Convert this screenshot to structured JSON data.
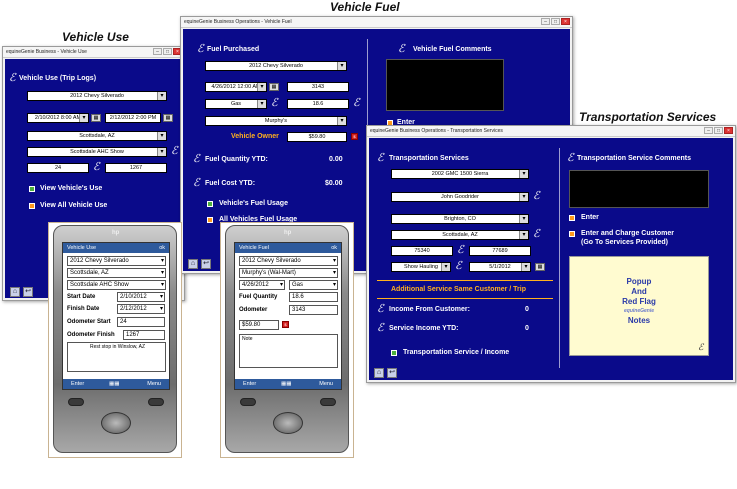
{
  "captions": {
    "vehicle_use": "Vehicle Use",
    "vehicle_fuel": "Vehicle Fuel",
    "transport": "Transportation Services"
  },
  "win_use": {
    "title": "equineGenie   Business - Vehicle Use",
    "heading": "Vehicle Use (Trip Logs)",
    "vehicle": "2012 Chevy Silverado",
    "start": "2/10/2012 8:00 AM",
    "finish": "2/12/2012 2:00 PM",
    "location": "Scottsdale, AZ",
    "event": "Scottsdale AHC Show",
    "odo_start": "24",
    "odo_finish": "1267",
    "btn_view": "View Vehicle's Use",
    "btn_all": "View All Vehicle Use"
  },
  "win_fuel": {
    "title": "equineGenie   Business Operations - Vehicle Fuel",
    "heading": "Fuel Purchased",
    "vehicle": "2012 Chevy Silverado",
    "date": "4/26/2012 12:00 AM",
    "qty": "3143",
    "fuel_type": "Gas",
    "price": "18.6",
    "vendor": "Murphy's",
    "owner_label": "Vehicle Owner",
    "owner_amount": "$59.80",
    "comments_label": "Vehicle Fuel Comments",
    "enter": "Enter",
    "qty_ytd_label": "Fuel Quantity YTD:",
    "qty_ytd": "0.00",
    "cost_ytd_label": "Fuel Cost YTD:",
    "cost_ytd": "$0.00",
    "btn_usage": "Vehicle's Fuel Usage",
    "btn_all": "All Vehicles Fuel Usage"
  },
  "win_trans": {
    "title": "equineGenie   Business Operations - Transportation Services",
    "heading": "Transportation Services",
    "comments_label": "Transportation Service Comments",
    "vehicle": "2002 GMC 1500 Sierra",
    "customer": "John Goodrider",
    "from": "Brighton, CO",
    "to": "Scottsdale, AZ",
    "miles_a": "75340",
    "miles_b": "77689",
    "service": "Show Hauling",
    "date": "5/1/2012",
    "enter": "Enter",
    "enter_charge": "Enter and Charge Customer",
    "enter_charge_sub": "(Go To Services Provided)",
    "additional": "Additional Service Same Customer / Trip",
    "income_label": "Income From Customer:",
    "income": "0",
    "service_ytd_label": "Service Income YTD:",
    "service_ytd": "0",
    "btn_income": "Transportation Service / Income",
    "popup_lines": [
      "Popup",
      "And",
      "Red Flag",
      "Notes"
    ],
    "popup_logo": "equineGenie"
  },
  "phone_use": {
    "title": "Vehicle Use",
    "ok": "ok",
    "vehicle": "2012 Chevy Silverado",
    "location": "Scottsdale, AZ",
    "event": "Scottsdale AHC Show",
    "start_label": "Start Date",
    "start": "2/10/2012",
    "finish_label": "Finish Date",
    "finish": "2/12/2012",
    "odo_start_label": "Odometer Start",
    "odo_start": "24",
    "odo_finish_label": "Odometer Finish",
    "odo_finish": "1267",
    "note": "Rest stop in Winslow, AZ",
    "enter": "Enter",
    "menu": "Menu",
    "brand": "hp"
  },
  "phone_fuel": {
    "title": "Vehicle Fuel",
    "ok": "ok",
    "vehicle": "2012 Chevy Silverado",
    "vendor": "Murphy's (Wal-Mart)",
    "date": "4/26/2012",
    "fuel_type": "Gas",
    "qty_label": "Fuel Quantity",
    "qty": "18.6",
    "odo_label": "Odometer",
    "odo": "3143",
    "amount": "$59.80",
    "note": "Note",
    "enter": "Enter",
    "menu": "Menu",
    "brand": "hp"
  },
  "colors": {
    "panel": "#0a0a8a",
    "accent": "#ffb01e",
    "green": "#4caf3c"
  }
}
